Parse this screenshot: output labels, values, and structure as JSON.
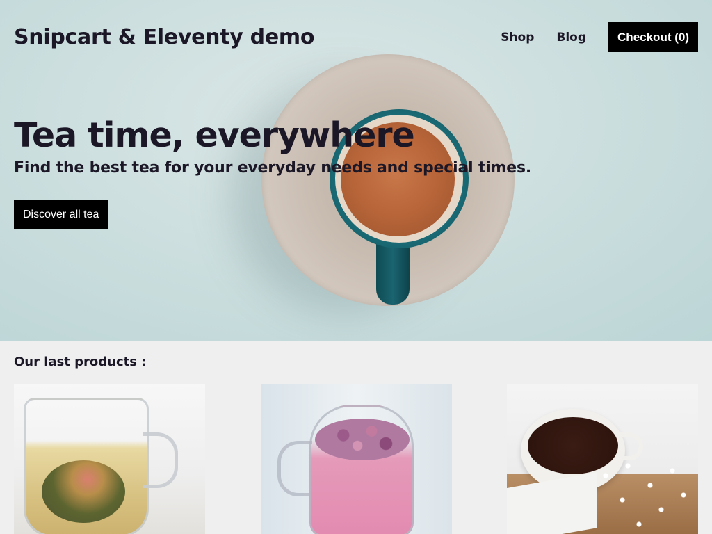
{
  "header": {
    "site_title": "Snipcart & Eleventy demo",
    "nav": [
      {
        "label": "Shop"
      },
      {
        "label": "Blog"
      }
    ],
    "checkout_label": "Checkout (0)"
  },
  "hero": {
    "title": "Tea time, everywhere",
    "subtitle": "Find the best tea for your everyday needs and special times.",
    "cta_label": "Discover all tea"
  },
  "products": {
    "heading": "Our last products :",
    "items": [
      {
        "image": "glass-cup-blooming-tea"
      },
      {
        "image": "glass-cup-pink-flower-tea"
      },
      {
        "image": "white-cup-dark-tea"
      }
    ]
  },
  "colors": {
    "text": "#1b1726",
    "button_bg": "#000000",
    "button_text": "#ffffff",
    "hero_bg": "#cfe0e0",
    "page_bg": "#efefef"
  }
}
